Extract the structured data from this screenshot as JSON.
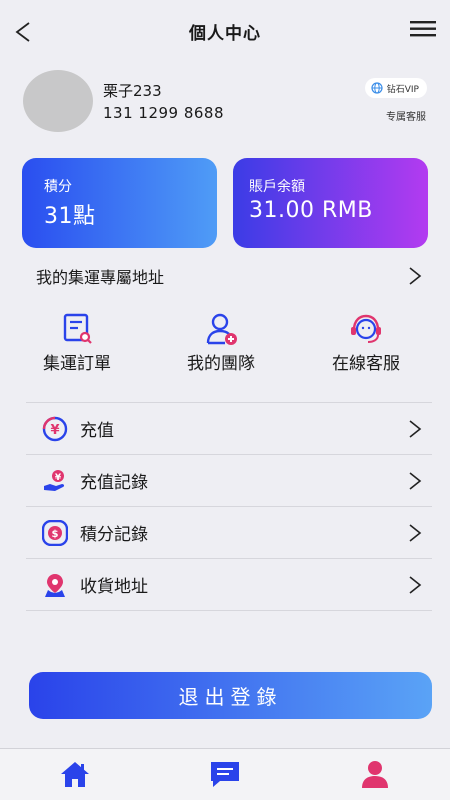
{
  "header": {
    "title": "個人中心",
    "back_icon": "chevron-left-icon",
    "menu_icon": "hamburger-menu-icon"
  },
  "profile": {
    "username": "栗子233",
    "phone": "131 1299 8688",
    "vip_label": "钻石VIP",
    "service_label": "专属客服"
  },
  "cards": {
    "points": {
      "label": "積分",
      "value": "31點"
    },
    "balance": {
      "label": "賬戶余額",
      "value": "31.00 RMB"
    }
  },
  "address_row": {
    "label": "我的集運專屬地址"
  },
  "quick_actions": [
    {
      "label": "集運訂單",
      "icon": "order-search-icon"
    },
    {
      "label": "我的團隊",
      "icon": "team-add-user-icon"
    },
    {
      "label": "在線客服",
      "icon": "customer-service-headset-icon"
    }
  ],
  "menu": [
    {
      "label": "充值",
      "icon": "yen-coin-icon"
    },
    {
      "label": "充值記錄",
      "icon": "yen-hand-icon"
    },
    {
      "label": "積分記錄",
      "icon": "points-coin-icon"
    },
    {
      "label": "收貨地址",
      "icon": "location-pin-icon"
    }
  ],
  "logout": {
    "label": "退出登錄"
  },
  "tabbar": [
    {
      "icon": "home-icon"
    },
    {
      "icon": "message-icon"
    },
    {
      "icon": "user-profile-icon",
      "active": true
    }
  ],
  "colors": {
    "accent_blue": "#2a43ea",
    "accent_purple": "#b33bf0",
    "accent_pink": "#e0356e",
    "page_bg": "#eeeef3"
  }
}
